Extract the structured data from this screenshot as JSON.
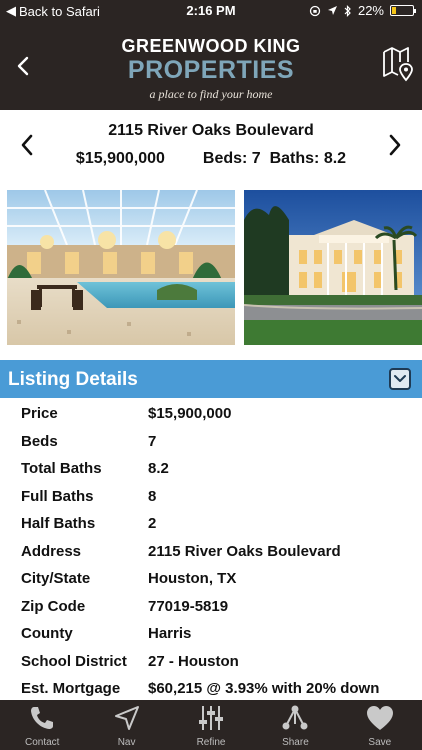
{
  "status_bar": {
    "back_label": "Back to Safari",
    "time": "2:16 PM",
    "battery_percent": "22%",
    "battery_level": 0.22
  },
  "brand": {
    "line1": "GREENWOOD KING",
    "line2": "PROPERTIES",
    "tagline": "a place to find your home"
  },
  "listing": {
    "address": "2115 River Oaks Boulevard",
    "price": "$15,900,000",
    "beds_label": "Beds: 7",
    "baths_label": "Baths: 8.2"
  },
  "details": {
    "section_title": "Listing Details",
    "rows": [
      {
        "label": "Price",
        "value": "$15,900,000"
      },
      {
        "label": "Beds",
        "value": "7"
      },
      {
        "label": "Total Baths",
        "value": "8.2"
      },
      {
        "label": "Full Baths",
        "value": "8"
      },
      {
        "label": "Half Baths",
        "value": "2"
      },
      {
        "label": "Address",
        "value": "2115 River Oaks Boulevard"
      },
      {
        "label": "City/State",
        "value": "Houston, TX"
      },
      {
        "label": "Zip Code",
        "value": "77019-5819"
      },
      {
        "label": "County",
        "value": "Harris"
      },
      {
        "label": "School District",
        "value": "27 - Houston"
      },
      {
        "label": "Est. Mortgage",
        "value": "$60,215 @ 3.93% with 20% down"
      }
    ]
  },
  "tabs": [
    {
      "label": "Contact",
      "icon": "phone-icon"
    },
    {
      "label": "Nav",
      "icon": "navigation-arrow-icon"
    },
    {
      "label": "Refine",
      "icon": "sliders-icon"
    },
    {
      "label": "Share",
      "icon": "share-icon"
    },
    {
      "label": "Save",
      "icon": "heart-icon"
    }
  ],
  "colors": {
    "header_bg": "#2b2523",
    "accent_blue": "#4a9bd6",
    "brand_blue": "#7fa6b9",
    "battery": "#f5c518"
  }
}
